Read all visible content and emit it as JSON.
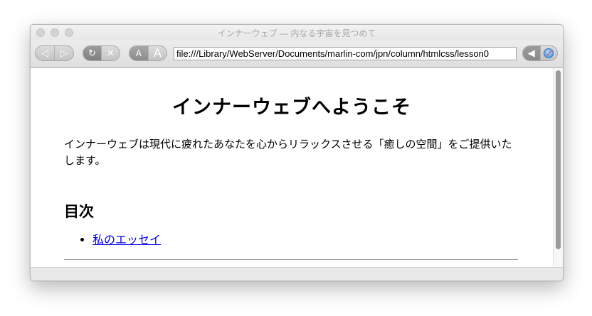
{
  "window": {
    "title": "インナーウェブ — 内なる宇宙を見つめて"
  },
  "toolbar": {
    "back_icon": "◁",
    "forward_icon": "▷",
    "reload_icon": "↻",
    "stop_icon": "✕",
    "text_smaller": "A",
    "text_larger": "A",
    "address": "file:///Library/WebServer/Documents/marlin-com/jpn/column/htmlcss/lesson0",
    "destination_back_icon": "◀"
  },
  "page": {
    "heading": "インナーウェブへようこそ",
    "intro": "インナーウェブは現代に疲れたあなたを心からリラックスさせる「癒しの空間」をご提供いたします。",
    "toc_heading": "目次",
    "toc_items": [
      {
        "label": "私のエッセイ"
      }
    ]
  }
}
